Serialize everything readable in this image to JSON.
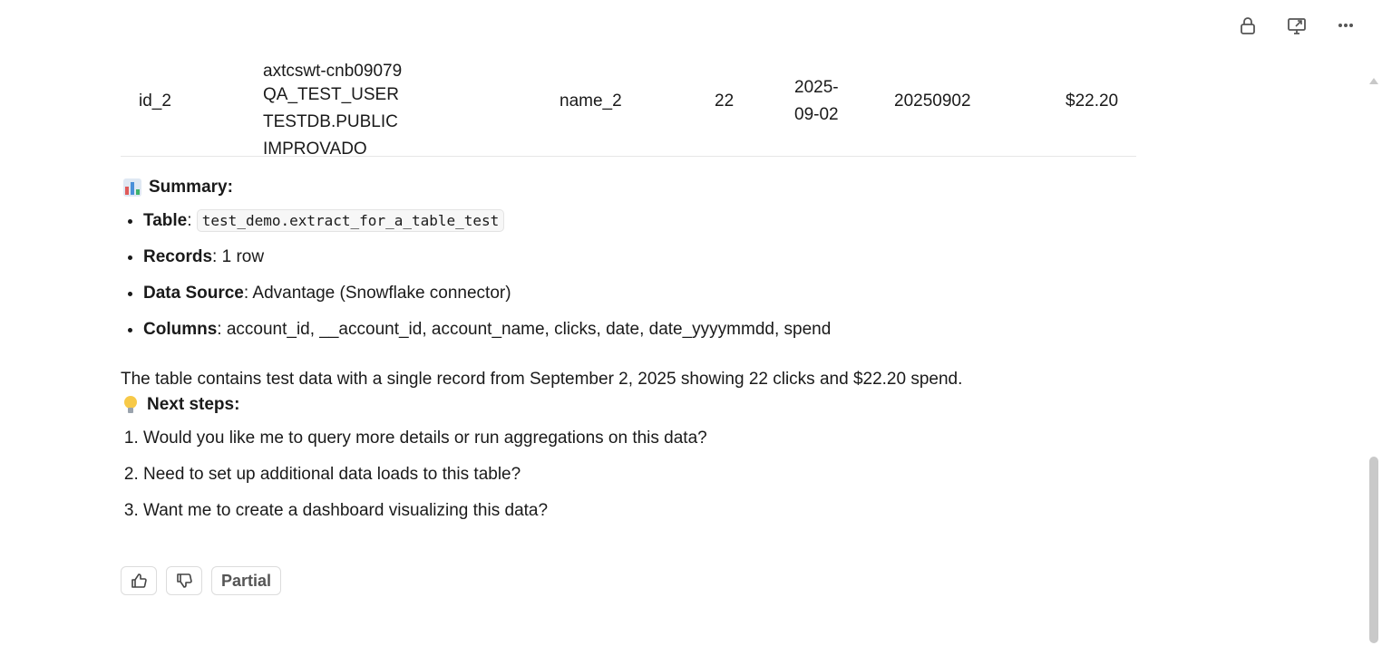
{
  "toolbar": {
    "icons": [
      "lock-icon",
      "monitor-arrow-icon",
      "more-icon"
    ]
  },
  "table_row": {
    "id": "id_2",
    "account_id_clipped": "axtcswt-cnb09079",
    "account_id_line2": "QA_TEST_USER TESTDB.PUBLIC",
    "account_id_line3": "IMPROVADO",
    "account_name": "name_2",
    "clicks": "22",
    "date_line1": "2025-",
    "date_line2": "09-02",
    "date_yyyymmdd": "20250902",
    "spend": "$22.20"
  },
  "summary": {
    "heading": "Summary:",
    "items": [
      {
        "label": "Table",
        "sep": ": ",
        "value": "test_demo.extract_for_a_table_test"
      },
      {
        "label": "Records",
        "sep": ": ",
        "value": "1 row"
      },
      {
        "label": "Data Source",
        "sep": ": ",
        "value": "Advantage (Snowflake connector)"
      },
      {
        "label": "Columns",
        "sep": ": ",
        "value": "account_id, __account_id, account_name, clicks, date, date_yyyymmdd, spend"
      }
    ]
  },
  "paragraph": "The table contains test data with a single record from September 2, 2025 showing 22 clicks and $22.20 spend.",
  "next_steps": {
    "heading": "Next steps:",
    "items": [
      "Would you like me to query more details or run aggregations on this data?",
      "Need to set up additional data loads to this table?",
      "Want me to create a dashboard visualizing this data?"
    ]
  },
  "feedback": {
    "partial_label": "Partial"
  }
}
